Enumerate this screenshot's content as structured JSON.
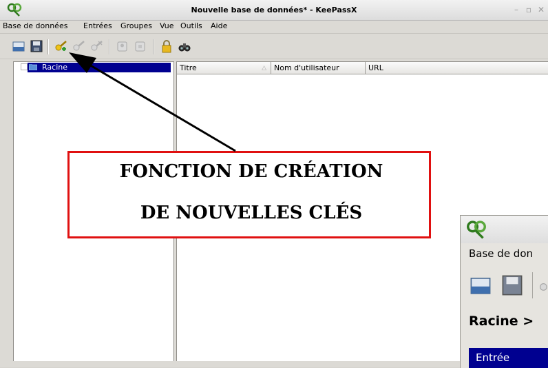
{
  "window": {
    "title": "Nouvelle base de données* - KeePassX"
  },
  "menu": [
    "Base de données",
    "Entrées",
    "Groupes",
    "Vue",
    "Outils",
    "Aide"
  ],
  "toolbar": {
    "icons": [
      "new-database-icon",
      "save-icon",
      "add-entry-icon",
      "edit-entry-icon",
      "clone-entry-icon",
      "copy-username-icon",
      "copy-password-icon",
      "lock-icon",
      "search-icon"
    ]
  },
  "tree": {
    "root_label": "Racine"
  },
  "entries": {
    "columns": [
      "Titre",
      "Nom d'utilisateur",
      "URL"
    ]
  },
  "callout": {
    "line1": "FONCTION DE CRÉATION",
    "line2": "DE NOUVELLES CLÉS"
  },
  "inset": {
    "menu_label": "Base de don",
    "breadcrumb": "Racine >",
    "selected_row": "Entrée"
  },
  "colors": {
    "selection": "#000090",
    "callout_border": "#e01010"
  }
}
